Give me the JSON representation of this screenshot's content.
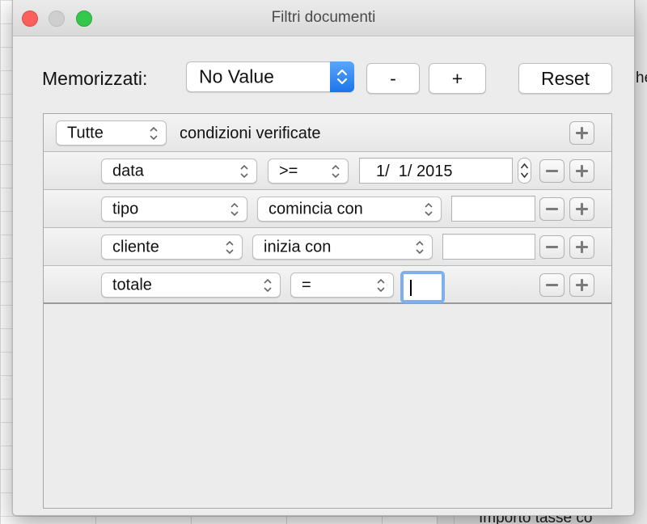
{
  "window": {
    "title": "Filtri documenti"
  },
  "saved": {
    "label": "Memorizzati:",
    "selected": "No Value",
    "remove_label": "-",
    "add_label": "+",
    "reset_label": "Reset"
  },
  "header_rule": {
    "quantifier": "Tutte",
    "suffix": "condizioni verificate"
  },
  "rules": [
    {
      "field": "data",
      "operator": ">=",
      "value": "1/  1/ 2015"
    },
    {
      "field": "tipo",
      "operator": "comincia con",
      "value": ""
    },
    {
      "field": "cliente",
      "operator": "inizia con",
      "value": ""
    },
    {
      "field": "totale",
      "operator": "=",
      "value": ""
    }
  ],
  "background": {
    "fragment_1": "he",
    "fragment_2": "Importo  tasse  co"
  },
  "colors": {
    "accent": "#1c74ea",
    "focus_ring": "#7fb0ea",
    "close": "#fc605c",
    "zoom": "#34c84a"
  }
}
